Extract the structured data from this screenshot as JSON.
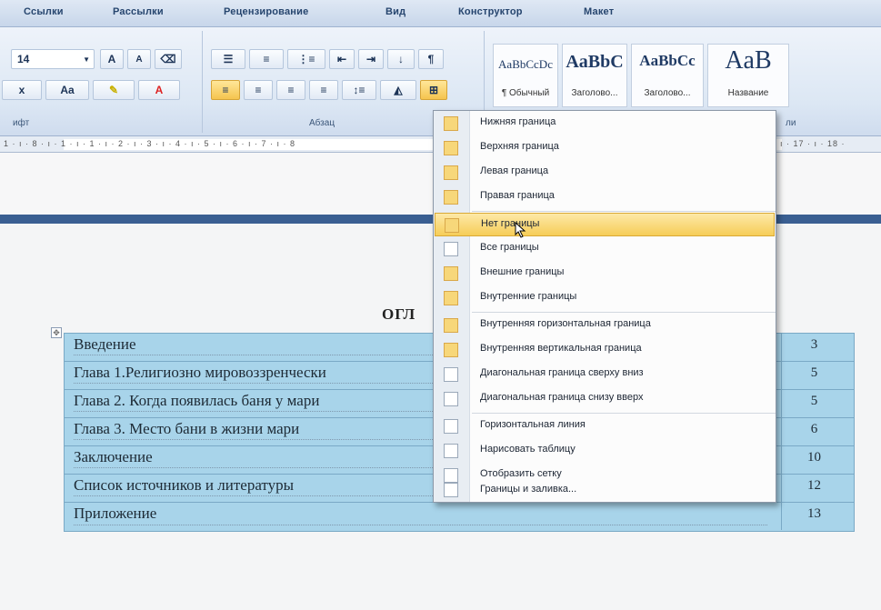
{
  "ribbon_tabs": [
    "Ссылки",
    "Рассылки",
    "Рецензирование",
    "Вид",
    "Конструктор",
    "Макет"
  ],
  "font": {
    "size_value": "14",
    "grow_label": "A",
    "shrink_label": "A",
    "subscript_label": "x",
    "change_case_label": "Aa",
    "group_label": "ифт"
  },
  "paragraph": {
    "group_label": "Абзац"
  },
  "styles": {
    "items": [
      {
        "sample": "AaBbCcDc",
        "name": "¶ Обычный"
      },
      {
        "sample": "AaBbC",
        "name": "Заголово..."
      },
      {
        "sample": "AaBbCc",
        "name": "Заголово..."
      },
      {
        "sample": "AaB",
        "name": "Название"
      }
    ],
    "group_label": "ли"
  },
  "ruler_text": "1 · ı · 8 · ı · 1 · ı · 1 · ı · 2 · ı · 3 · ı · 4 · ı · 5 · ı · 6 · ı · 7 · ı · 8",
  "ruler_right": "ı · 17 · ı · 18 ·",
  "document": {
    "heading": "ОГЛ",
    "toc": [
      {
        "title": "Введение",
        "page": "3"
      },
      {
        "title": "Глава 1.Религиозно мировоззренчески",
        "page": "5"
      },
      {
        "title": "Глава 2. Когда появилась баня у мари",
        "page": "5"
      },
      {
        "title": "Глава 3. Место бани в жизни мари",
        "page": "6"
      },
      {
        "title": "Заключение",
        "page": "10"
      },
      {
        "title": "Список источников и литературы",
        "page": "12"
      },
      {
        "title": "Приложение",
        "page": "13"
      }
    ]
  },
  "borders_menu": {
    "items": [
      {
        "label": "Нижняя граница",
        "icon": "bottom-border-icon"
      },
      {
        "label": "Верхняя граница",
        "icon": "top-border-icon"
      },
      {
        "label": "Левая граница",
        "icon": "left-border-icon"
      },
      {
        "label": "Правая граница",
        "icon": "right-border-icon"
      },
      {
        "label": "Нет границы",
        "icon": "no-border-icon"
      },
      {
        "label": "Все границы",
        "icon": "all-borders-icon"
      },
      {
        "label": "Внешние границы",
        "icon": "outside-borders-icon"
      },
      {
        "label": "Внутренние границы",
        "icon": "inside-borders-icon"
      },
      {
        "label": "Внутренняя горизонтальная граница",
        "icon": "inside-horizontal-border-icon"
      },
      {
        "label": "Внутренняя вертикальная граница",
        "icon": "inside-vertical-border-icon"
      },
      {
        "label": "Диагональная граница сверху вниз",
        "icon": "diagonal-down-border-icon"
      },
      {
        "label": "Диагональная граница снизу вверх",
        "icon": "diagonal-up-border-icon"
      },
      {
        "label": "Горизонтальная линия",
        "icon": "horizontal-line-icon"
      },
      {
        "label": "Нарисовать таблицу",
        "icon": "draw-table-icon"
      },
      {
        "label": "Отобразить сетку",
        "icon": "view-gridlines-icon"
      },
      {
        "label": "Границы и заливка...",
        "icon": "borders-shading-icon"
      }
    ],
    "active_index": 4
  },
  "colors": {
    "ribbon_tab_text": "#26456e",
    "table_highlight": "#a8d4ea",
    "menu_hover": "#f6cd58",
    "page_break": "#3a5f92"
  }
}
